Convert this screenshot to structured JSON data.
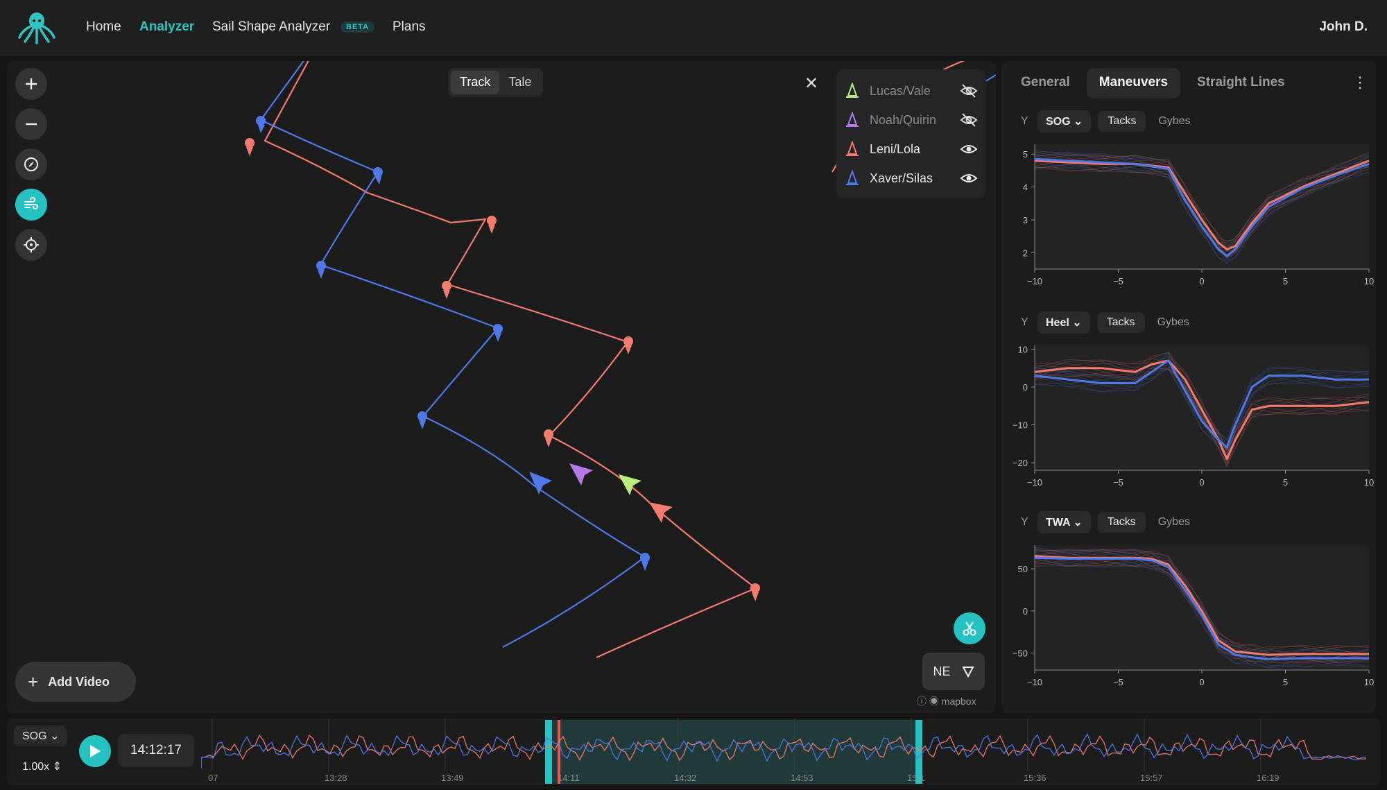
{
  "nav": {
    "home": "Home",
    "analyzer": "Analyzer",
    "sail_shape": "Sail Shape Analyzer",
    "beta": "BETA",
    "plans": "Plans",
    "user": "John D."
  },
  "map": {
    "view_tabs": [
      "Track",
      "Tale"
    ],
    "selected_view": "Track",
    "boats": [
      {
        "name": "Lucas/Vale",
        "color": "#b9ef7a",
        "visible": false
      },
      {
        "name": "Noah/Quirin",
        "color": "#b47be8",
        "visible": false
      },
      {
        "name": "Leni/Lola",
        "color": "#f47b6e",
        "visible": true
      },
      {
        "name": "Xaver/Silas",
        "color": "#4f79e8",
        "visible": true
      }
    ],
    "add_video": "Add Video",
    "wind_direction": "NE",
    "attribution": "mapbox"
  },
  "panel": {
    "tabs": [
      "General",
      "Maneuvers",
      "Straight Lines"
    ],
    "selected_tab": "Maneuvers",
    "charts": [
      {
        "y_label": "Y",
        "metric": "SOG",
        "tacks": "Tacks",
        "gybes": "Gybes"
      },
      {
        "y_label": "Y",
        "metric": "Heel",
        "tacks": "Tacks",
        "gybes": "Gybes"
      },
      {
        "y_label": "Y",
        "metric": "TWA",
        "tacks": "Tacks",
        "gybes": "Gybes"
      }
    ]
  },
  "chart_data": [
    {
      "type": "line",
      "metric": "SOG",
      "xlim": [
        -10,
        10
      ],
      "ylim": [
        1.5,
        5.3
      ],
      "xticks": [
        "−10",
        "−5",
        "0",
        "5",
        "10"
      ],
      "yticks": [
        "2",
        "3",
        "4",
        "5"
      ],
      "x": [
        -10,
        -8,
        -6,
        -4,
        -2,
        -1,
        0,
        1,
        1.5,
        2,
        3,
        4,
        6,
        8,
        10
      ],
      "series": [
        {
          "color": "#f47b6e",
          "values": [
            4.8,
            4.75,
            4.7,
            4.7,
            4.6,
            3.8,
            3.0,
            2.3,
            2.1,
            2.2,
            2.9,
            3.5,
            4.0,
            4.4,
            4.8
          ]
        },
        {
          "color": "#4f79e8",
          "values": [
            4.85,
            4.8,
            4.75,
            4.7,
            4.55,
            3.6,
            2.8,
            2.1,
            1.9,
            2.1,
            2.8,
            3.4,
            3.95,
            4.35,
            4.7
          ]
        }
      ]
    },
    {
      "type": "line",
      "metric": "Heel",
      "xlim": [
        -10,
        10
      ],
      "ylim": [
        -22,
        11
      ],
      "xticks": [
        "−10",
        "−5",
        "0",
        "5",
        "10"
      ],
      "yticks": [
        "10",
        "0",
        "−10",
        "−20"
      ],
      "x": [
        -10,
        -8,
        -6,
        -4,
        -3,
        -2,
        -1,
        0,
        1,
        1.5,
        2,
        3,
        4,
        6,
        8,
        10
      ],
      "series": [
        {
          "color": "#f47b6e",
          "values": [
            4,
            5,
            5,
            4,
            6,
            7,
            2,
            -6,
            -14,
            -19,
            -14,
            -6,
            -5,
            -5,
            -5,
            -4
          ]
        },
        {
          "color": "#4f79e8",
          "values": [
            3,
            2,
            1,
            1,
            4,
            7,
            -1,
            -9,
            -14,
            -16,
            -10,
            0,
            3,
            3,
            2,
            2
          ]
        }
      ]
    },
    {
      "type": "line",
      "metric": "TWA",
      "xlim": [
        -10,
        10
      ],
      "ylim": [
        -70,
        78
      ],
      "xticks": [
        "−10",
        "−5",
        "0",
        "5",
        "10"
      ],
      "yticks": [
        "50",
        "0",
        "−50"
      ],
      "x": [
        -10,
        -8,
        -6,
        -4,
        -3,
        -2,
        -1,
        0,
        1,
        2,
        3,
        4,
        6,
        8,
        10
      ],
      "series": [
        {
          "color": "#f47b6e",
          "values": [
            65,
            63,
            63,
            63,
            62,
            55,
            30,
            0,
            -35,
            -48,
            -50,
            -52,
            -51,
            -51,
            -51
          ]
        },
        {
          "color": "#4f79e8",
          "values": [
            63,
            62,
            62,
            62,
            60,
            52,
            25,
            -5,
            -40,
            -52,
            -55,
            -57,
            -56,
            -56,
            -56
          ]
        }
      ]
    }
  ],
  "timeline": {
    "metric": "SOG",
    "speed": "1.00x",
    "current_time": "14:12:17",
    "ticks": [
      "07",
      "13:28",
      "13:49",
      "14:11",
      "14:32",
      "14:53",
      "15:1",
      "15:36",
      "15:57",
      "16:19"
    ]
  }
}
